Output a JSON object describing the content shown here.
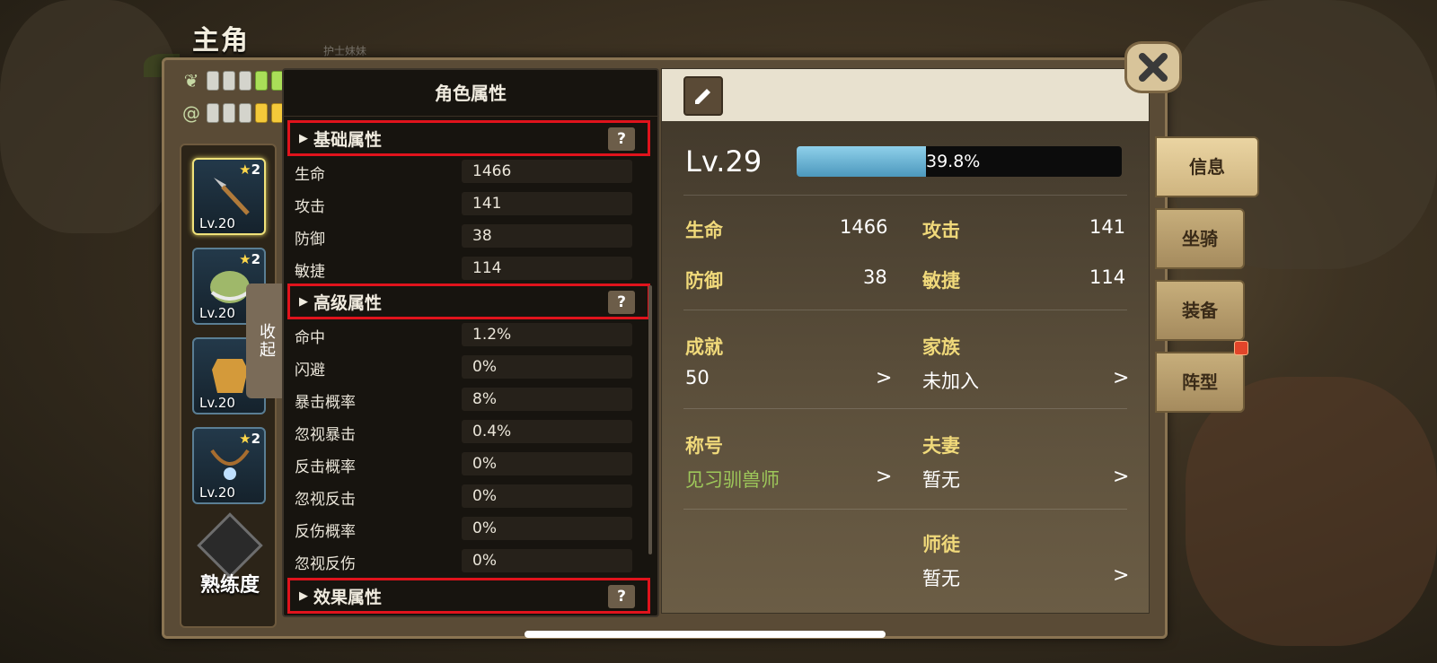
{
  "header": {
    "title": "主角",
    "subtitle": "护士妹妹"
  },
  "equipment": [
    {
      "level": "Lv.20",
      "stars": "2",
      "icon": "spear-icon",
      "selected": true
    },
    {
      "level": "Lv.20",
      "stars": "2",
      "icon": "helmet-icon",
      "selected": false
    },
    {
      "level": "Lv.20",
      "stars": "",
      "icon": "armor-icon",
      "selected": false
    },
    {
      "level": "Lv.20",
      "stars": "2",
      "icon": "necklace-icon",
      "selected": false
    }
  ],
  "mastery": {
    "label": "熟练度"
  },
  "collapse": {
    "label": "收起"
  },
  "attr_panel": {
    "title": "角色属性",
    "sections": {
      "basic": "基础属性",
      "advanced": "高级属性",
      "effect": "效果属性"
    },
    "help": "?",
    "basic_rows": [
      {
        "label": "生命",
        "value": "1466"
      },
      {
        "label": "攻击",
        "value": "141"
      },
      {
        "label": "防御",
        "value": "38"
      },
      {
        "label": "敏捷",
        "value": "114"
      }
    ],
    "advanced_rows": [
      {
        "label": "命中",
        "value": "1.2%"
      },
      {
        "label": "闪避",
        "value": "0%"
      },
      {
        "label": "暴击概率",
        "value": "8%"
      },
      {
        "label": "忽视暴击",
        "value": "0.4%"
      },
      {
        "label": "反击概率",
        "value": "0%"
      },
      {
        "label": "忽视反击",
        "value": "0%"
      },
      {
        "label": "反伤概率",
        "value": "0%"
      },
      {
        "label": "忽视反伤",
        "value": "0%"
      }
    ]
  },
  "info": {
    "level": "Lv.29",
    "xp_percent_text": "39.8%",
    "xp_fraction": 0.398,
    "stats": {
      "hp_label": "生命",
      "hp": "1466",
      "atk_label": "攻击",
      "atk": "141",
      "def_label": "防御",
      "def": "38",
      "agi_label": "敏捷",
      "agi": "114"
    },
    "achievement_label": "成就",
    "achievement": "50",
    "clan_label": "家族",
    "clan": "未加入",
    "title_label": "称号",
    "title_value": "见习驯兽师",
    "spouse_label": "夫妻",
    "spouse": "暂无",
    "mentor_label": "师徒",
    "mentor": "暂无",
    "arrow": ">"
  },
  "side_tabs": [
    "信息",
    "坐骑",
    "装备",
    "阵型"
  ],
  "colors": {
    "highlight_red": "#e0131c",
    "xp_blue": "#6fb8da",
    "gold_label": "#f0d97a",
    "green_title": "#9ec85a"
  }
}
